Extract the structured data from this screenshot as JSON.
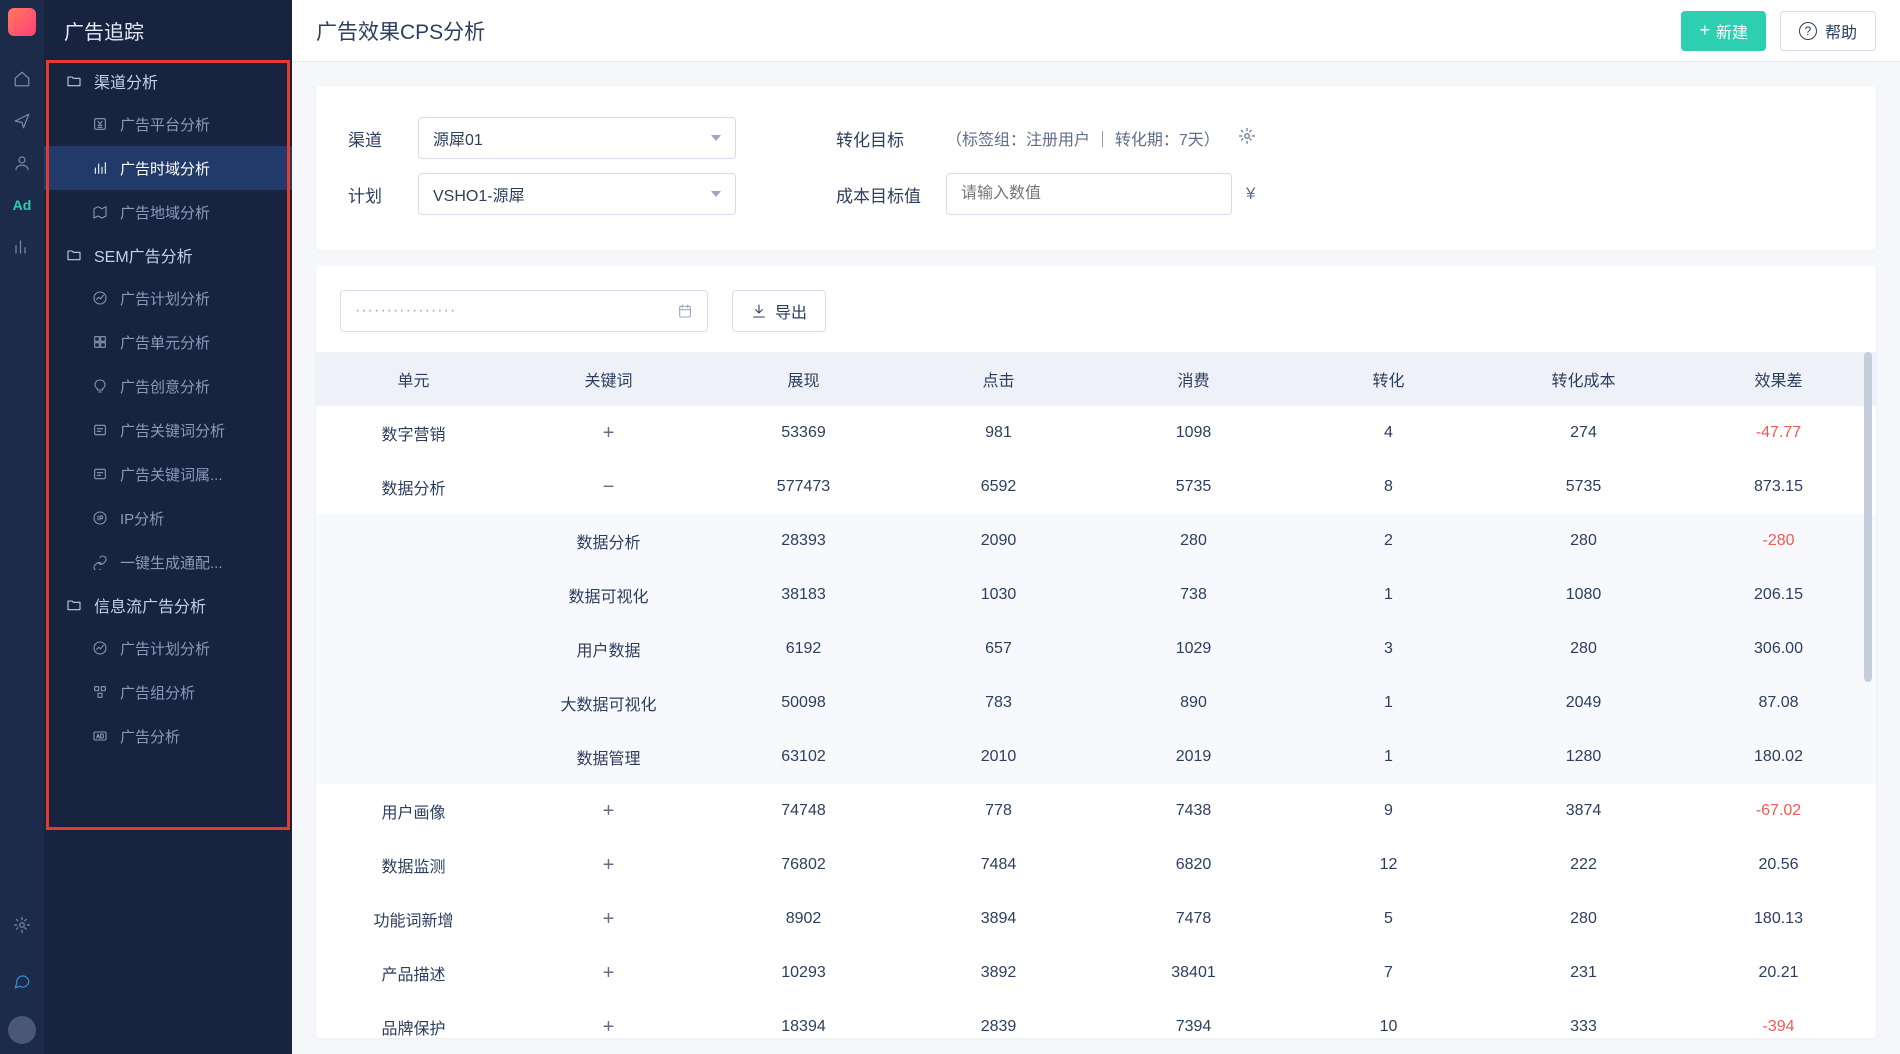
{
  "app_title": "广告追踪",
  "page_title": "广告效果CPS分析",
  "header": {
    "new_btn": "新建",
    "help_btn": "帮助"
  },
  "rail": {
    "ad_label": "Ad"
  },
  "sidebar": {
    "cat_channel": "渠道分析",
    "items_channel": [
      "广告平台分析",
      "广告时域分析",
      "广告地域分析"
    ],
    "cat_sem": "SEM广告分析",
    "items_sem": [
      "广告计划分析",
      "广告单元分析",
      "广告创意分析",
      "广告关键词分析",
      "广告关键词属...",
      "IP分析",
      "一键生成通配..."
    ],
    "cat_feed": "信息流广告分析",
    "items_feed": [
      "广告计划分析",
      "广告组分析",
      "广告分析"
    ]
  },
  "filters": {
    "channel_label": "渠道",
    "channel_value": "源犀01",
    "plan_label": "计划",
    "plan_value": "VSHO1-源犀",
    "goal_label": "转化目标",
    "goal_text": "（标签组：注册用户 ｜ 转化期：7天）",
    "cost_label": "成本目标值",
    "cost_placeholder": "请输入数值",
    "currency": "¥"
  },
  "toolbar": {
    "date_placeholder": "················",
    "export": "导出"
  },
  "table": {
    "headers": [
      "单元",
      "关键词",
      "展现",
      "点击",
      "消费",
      "转化",
      "转化成本",
      "效果差"
    ],
    "rows": [
      {
        "unit": "数字营销",
        "kw": "+",
        "show": "53369",
        "click": "981",
        "spend": "1098",
        "conv": "4",
        "cost": "274",
        "diff": "-47.77",
        "neg": true
      },
      {
        "unit": "数据分析",
        "kw": "−",
        "show": "577473",
        "click": "6592",
        "spend": "5735",
        "conv": "8",
        "cost": "5735",
        "diff": "873.15"
      },
      {
        "sub": true,
        "unit": "",
        "kw": "数据分析",
        "show": "28393",
        "click": "2090",
        "spend": "280",
        "conv": "2",
        "cost": "280",
        "diff": "-280",
        "neg": true
      },
      {
        "sub": true,
        "unit": "",
        "kw": "数据可视化",
        "show": "38183",
        "click": "1030",
        "spend": "738",
        "conv": "1",
        "cost": "1080",
        "diff": "206.15"
      },
      {
        "sub": true,
        "unit": "",
        "kw": "用户数据",
        "show": "6192",
        "click": "657",
        "spend": "1029",
        "conv": "3",
        "cost": "280",
        "diff": "306.00"
      },
      {
        "sub": true,
        "unit": "",
        "kw": "大数据可视化",
        "show": "50098",
        "click": "783",
        "spend": "890",
        "conv": "1",
        "cost": "2049",
        "diff": "87.08"
      },
      {
        "sub": true,
        "unit": "",
        "kw": "数据管理",
        "show": "63102",
        "click": "2010",
        "spend": "2019",
        "conv": "1",
        "cost": "1280",
        "diff": "180.02"
      },
      {
        "unit": "用户画像",
        "kw": "+",
        "show": "74748",
        "click": "778",
        "spend": "7438",
        "conv": "9",
        "cost": "3874",
        "diff": "-67.02",
        "neg": true
      },
      {
        "unit": "数据监测",
        "kw": "+",
        "show": "76802",
        "click": "7484",
        "spend": "6820",
        "conv": "12",
        "cost": "222",
        "diff": "20.56"
      },
      {
        "unit": "功能词新增",
        "kw": "+",
        "show": "8902",
        "click": "3894",
        "spend": "7478",
        "conv": "5",
        "cost": "280",
        "diff": "180.13"
      },
      {
        "unit": "产品描述",
        "kw": "+",
        "show": "10293",
        "click": "3892",
        "spend": "38401",
        "conv": "7",
        "cost": "231",
        "diff": "20.21"
      },
      {
        "unit": "品牌保护",
        "kw": "+",
        "show": "18394",
        "click": "2839",
        "spend": "7394",
        "conv": "10",
        "cost": "333",
        "diff": "-394",
        "neg": true
      }
    ]
  }
}
